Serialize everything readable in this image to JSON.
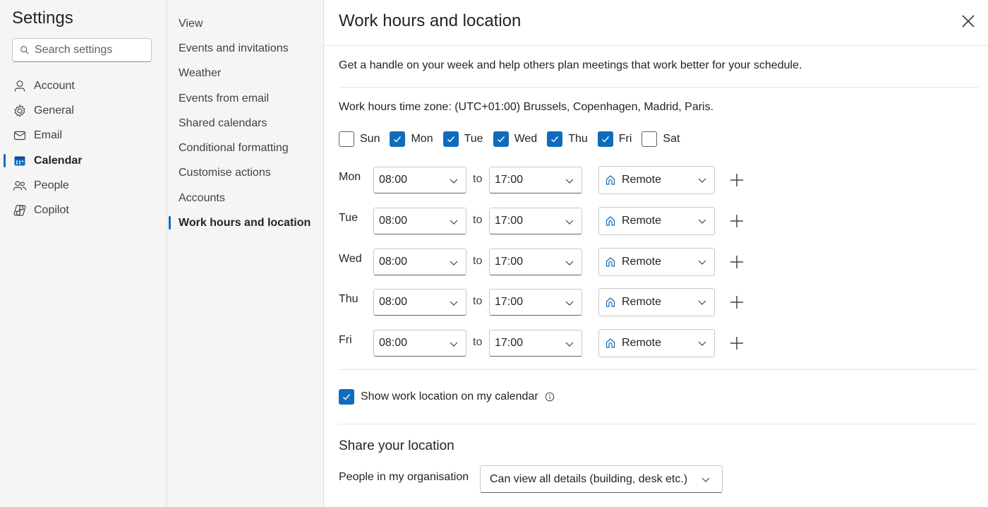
{
  "sidebar": {
    "title": "Settings",
    "search_placeholder": "Search settings",
    "items": [
      {
        "label": "Account",
        "icon": "person-icon"
      },
      {
        "label": "General",
        "icon": "gear-icon"
      },
      {
        "label": "Email",
        "icon": "mail-icon"
      },
      {
        "label": "Calendar",
        "icon": "calendar-icon",
        "active": true
      },
      {
        "label": "People",
        "icon": "people-icon"
      },
      {
        "label": "Copilot",
        "icon": "copilot-icon"
      }
    ]
  },
  "subnav": {
    "items": [
      {
        "label": "View"
      },
      {
        "label": "Events and invitations"
      },
      {
        "label": "Weather"
      },
      {
        "label": "Events from email"
      },
      {
        "label": "Shared calendars"
      },
      {
        "label": "Conditional formatting"
      },
      {
        "label": "Customise actions"
      },
      {
        "label": "Accounts"
      },
      {
        "label": "Work hours and location",
        "active": true
      }
    ]
  },
  "main": {
    "title": "Work hours and location",
    "description": "Get a handle on your week and help others plan meetings that work better for your schedule.",
    "timezone": "Work hours time zone: (UTC+01:00) Brussels, Copenhagen, Madrid, Paris.",
    "days": [
      {
        "label": "Sun",
        "checked": false
      },
      {
        "label": "Mon",
        "checked": true
      },
      {
        "label": "Tue",
        "checked": true
      },
      {
        "label": "Wed",
        "checked": true
      },
      {
        "label": "Thu",
        "checked": true
      },
      {
        "label": "Fri",
        "checked": true
      },
      {
        "label": "Sat",
        "checked": false
      }
    ],
    "to_label": "to",
    "schedule": [
      {
        "day": "Mon",
        "start": "08:00",
        "end": "17:00",
        "location": "Remote"
      },
      {
        "day": "Tue",
        "start": "08:00",
        "end": "17:00",
        "location": "Remote"
      },
      {
        "day": "Wed",
        "start": "08:00",
        "end": "17:00",
        "location": "Remote"
      },
      {
        "day": "Thu",
        "start": "08:00",
        "end": "17:00",
        "location": "Remote"
      },
      {
        "day": "Fri",
        "start": "08:00",
        "end": "17:00",
        "location": "Remote"
      }
    ],
    "show_location_label": "Show work location on my calendar",
    "show_location_checked": true,
    "share_title": "Share your location",
    "people_label": "People in my organisation",
    "share_value": "Can view all details (building, desk etc.)"
  },
  "colors": {
    "accent": "#0f6cbd",
    "pane_bg": "#f5f5f5"
  }
}
